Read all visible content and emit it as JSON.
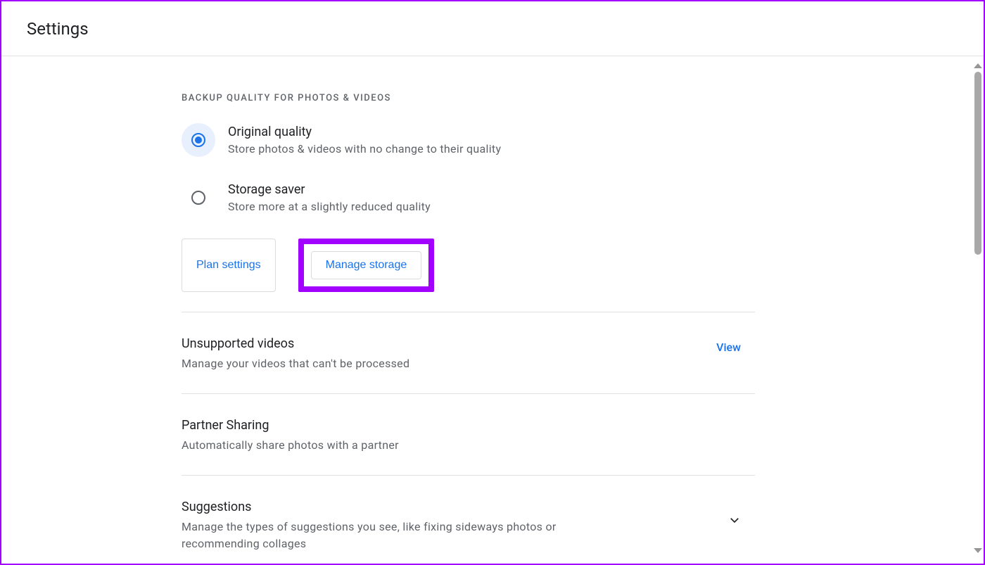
{
  "header": {
    "title": "Settings"
  },
  "backup": {
    "section_label": "BACKUP QUALITY FOR PHOTOS & VIDEOS",
    "options": [
      {
        "title": "Original quality",
        "desc": "Store photos & videos with no change to their quality"
      },
      {
        "title": "Storage saver",
        "desc": "Store more at a slightly reduced quality"
      }
    ],
    "plan_button": "Plan settings",
    "manage_button": "Manage storage"
  },
  "rows": {
    "unsupported": {
      "title": "Unsupported videos",
      "desc": "Manage your videos that can't be processed",
      "action": "View"
    },
    "partner": {
      "title": "Partner Sharing",
      "desc": "Automatically share photos with a partner"
    },
    "suggestions": {
      "title": "Suggestions",
      "desc": "Manage the types of suggestions you see, like fixing sideways photos or recommending collages"
    }
  }
}
